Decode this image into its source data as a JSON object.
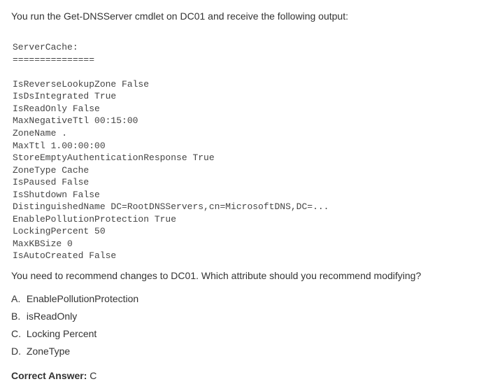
{
  "stem": "You run the Get-DNSServer cmdlet on DC01 and receive the following output:",
  "code": {
    "header_label": "ServerCache:",
    "divider": "===============",
    "lines": [
      "IsReverseLookupZone False",
      "IsDsIntegrated True",
      "IsReadOnly False",
      "MaxNegativeTtl 00:15:00",
      "ZoneName .",
      "MaxTtl 1.00:00:00",
      "StoreEmptyAuthenticationResponse True",
      "ZoneType Cache",
      "IsPaused False",
      "IsShutdown False",
      "DistinguishedName DC=RootDNSServers,cn=MicrosoftDNS,DC=...",
      "EnablePollutionProtection True",
      "LockingPercent 50",
      "MaxKBSize 0",
      "IsAutoCreated False"
    ]
  },
  "question": "You need to recommend changes to DC01. Which attribute should you recommend modifying?",
  "options": [
    {
      "letter": "A.",
      "text": "EnablePollutionProtection"
    },
    {
      "letter": "B.",
      "text": "isReadOnly"
    },
    {
      "letter": "C.",
      "text": "Locking Percent"
    },
    {
      "letter": "D.",
      "text": "ZoneType"
    }
  ],
  "answer": {
    "label": "Correct Answer:",
    "value": "C"
  }
}
